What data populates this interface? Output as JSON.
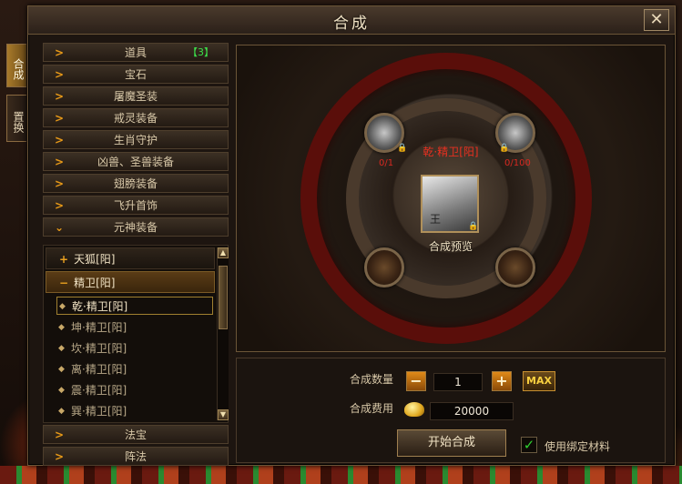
{
  "window": {
    "title": "合成",
    "close_label": "✕"
  },
  "side_tabs": [
    {
      "label": "合成",
      "active": true
    },
    {
      "label": "置换",
      "active": false
    }
  ],
  "categories_top": [
    {
      "label": "道具",
      "badge": "【3】"
    },
    {
      "label": "宝石"
    },
    {
      "label": "屠魔圣装"
    },
    {
      "label": "戒灵装备"
    },
    {
      "label": "生肖守护"
    },
    {
      "label": "凶兽、圣兽装备"
    },
    {
      "label": "翅膀装备"
    },
    {
      "label": "飞升首饰"
    },
    {
      "label": "元神装备"
    }
  ],
  "subcategories": [
    {
      "label": "天狐[阳]",
      "sign": "+"
    },
    {
      "label": "精卫[阳]",
      "sign": "−"
    }
  ],
  "items": [
    "乾·精卫[阳]",
    "坤·精卫[阳]",
    "坎·精卫[阳]",
    "离·精卫[阳]",
    "震·精卫[阳]",
    "巽·精卫[阳]"
  ],
  "categories_bottom": [
    {
      "label": "法宝"
    },
    {
      "label": "阵法"
    }
  ],
  "synth": {
    "target_name": "乾·精卫[阳]",
    "preview_label": "合成预览",
    "center_glyph": "王",
    "material_left_count": "0/1",
    "material_right_count": "0/100"
  },
  "controls": {
    "quantity_label": "合成数量",
    "quantity_value": "1",
    "minus_label": "−",
    "plus_label": "+",
    "max_label": "MAX",
    "cost_label": "合成费用",
    "cost_value": "20000",
    "start_label": "开始合成",
    "bind_label": "使用绑定材料",
    "bind_checked": true
  },
  "colors": {
    "accent": "#e8a020",
    "red_text": "#e83020",
    "green": "#3ce04a"
  }
}
